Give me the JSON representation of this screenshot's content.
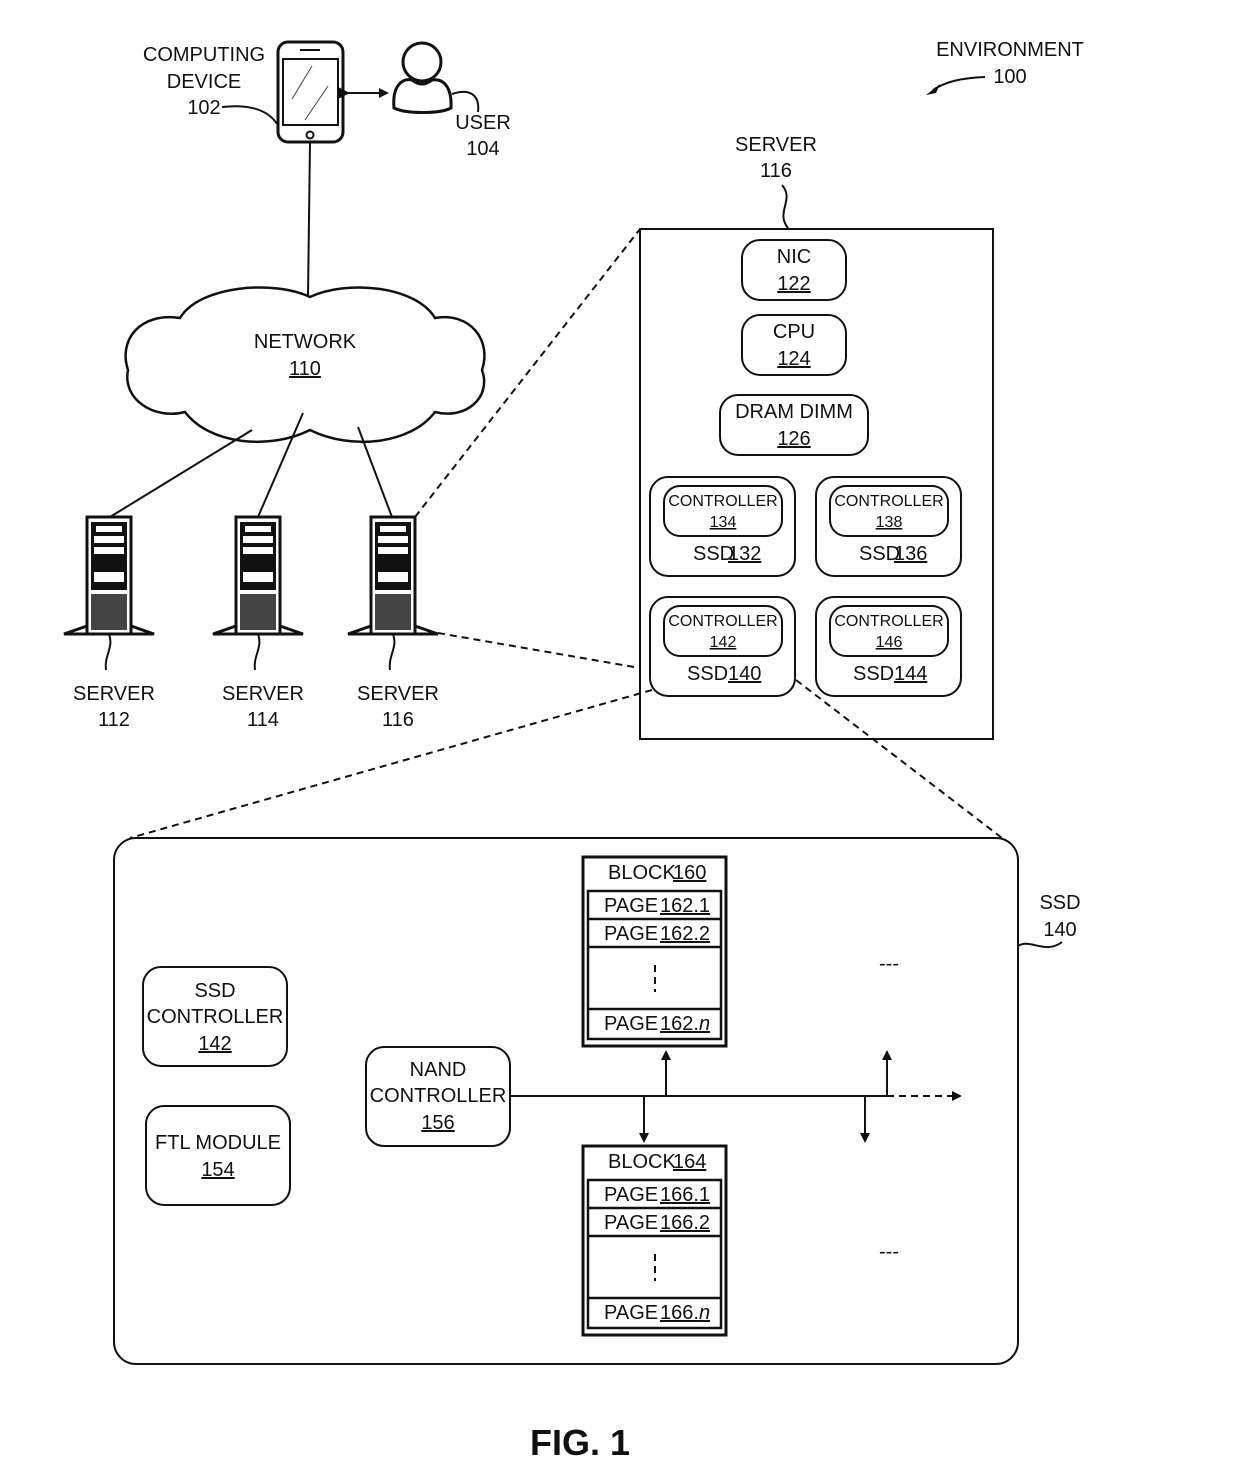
{
  "figure": {
    "caption": "FIG. 1",
    "environment": {
      "label": "ENVIRONMENT",
      "ref": "100"
    }
  },
  "computing_device": {
    "line1": "COMPUTING",
    "line2": "DEVICE",
    "ref": "102"
  },
  "user": {
    "label": "USER",
    "ref": "104"
  },
  "network": {
    "label": "NETWORK",
    "ref": "110"
  },
  "servers": [
    {
      "label": "SERVER",
      "ref": "112"
    },
    {
      "label": "SERVER",
      "ref": "114"
    },
    {
      "label": "SERVER",
      "ref": "116"
    }
  ],
  "server_detail": {
    "label": "SERVER",
    "ref": "116",
    "nic": {
      "label": "NIC",
      "ref": "122"
    },
    "cpu": {
      "label": "CPU",
      "ref": "124"
    },
    "dram": {
      "label": "DRAM DIMM",
      "ref": "126"
    },
    "ssds": [
      {
        "label": "SSD",
        "ref": "132",
        "controller_label": "CONTROLLER",
        "controller_ref": "134"
      },
      {
        "label": "SSD",
        "ref": "136",
        "controller_label": "CONTROLLER",
        "controller_ref": "138"
      },
      {
        "label": "SSD",
        "ref": "140",
        "controller_label": "CONTROLLER",
        "controller_ref": "142"
      },
      {
        "label": "SSD",
        "ref": "144",
        "controller_label": "CONTROLLER",
        "controller_ref": "146"
      }
    ]
  },
  "ssd_detail": {
    "label": "SSD",
    "ref": "140",
    "ssd_controller": {
      "line1": "SSD",
      "line2": "CONTROLLER",
      "ref": "142"
    },
    "ftl_module": {
      "label": "FTL MODULE",
      "ref": "154"
    },
    "nand_controller": {
      "line1": "NAND",
      "line2": "CONTROLLER",
      "ref": "156"
    },
    "blocks": [
      {
        "label": "BLOCK",
        "ref": "160",
        "pages": [
          {
            "label": "PAGE",
            "ref": "162.1"
          },
          {
            "label": "PAGE",
            "ref": "162.2"
          },
          {
            "label": "PAGE",
            "ref_prefix": "162.",
            "ref_suffix": "n"
          }
        ]
      },
      {
        "label": "BLOCK",
        "ref": "164",
        "pages": [
          {
            "label": "PAGE",
            "ref": "166.1"
          },
          {
            "label": "PAGE",
            "ref": "166.2"
          },
          {
            "label": "PAGE",
            "ref_prefix": "166.",
            "ref_suffix": "n"
          }
        ]
      }
    ],
    "ellipsis": "---"
  }
}
